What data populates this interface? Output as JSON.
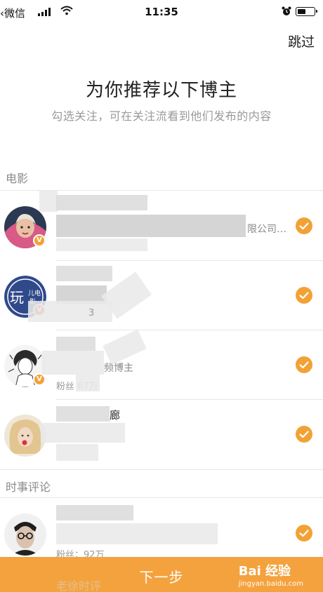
{
  "status_bar": {
    "back_app": "微信",
    "time": "11:35"
  },
  "header": {
    "skip_label": "跳过",
    "title": "为你推荐以下博主",
    "subtitle": "勾选关注，可在关注流看到他们发布的内容"
  },
  "sections": [
    {
      "title": "电影",
      "bloggers": [
        {
          "name": "",
          "desc": "限公司…",
          "fans": "",
          "verified": true,
          "checked": true,
          "avatar": "movie-character-avatar"
        },
        {
          "name": "",
          "desc": "",
          "fans": "3",
          "verified": true,
          "checked": true,
          "avatar": "movie-logo-avatar"
        },
        {
          "name": "",
          "desc": "频博主",
          "fans": "粉丝 67万",
          "verified": true,
          "checked": true,
          "avatar": "sketch-girl-avatar"
        },
        {
          "name": "廊",
          "desc": "",
          "fans": "",
          "verified": false,
          "checked": true,
          "avatar": "blonde-woman-avatar"
        }
      ]
    },
    {
      "title": "时事评论",
      "bloggers": [
        {
          "name": "",
          "desc": "",
          "fans": "粉丝：92万",
          "verified": false,
          "checked": true,
          "avatar": "man-glasses-avatar"
        }
      ]
    }
  ],
  "footer": {
    "next_label": "下一步",
    "peek_name": "老徐时评",
    "watermark_main": "Bai 经验",
    "watermark_sub": "jingyan.baidu.com"
  },
  "colors": {
    "accent": "#f4a23e",
    "check": "#f2a235",
    "verified": "#f2a235"
  },
  "icons": [
    "back-icon",
    "signal-icon",
    "wifi-icon",
    "alarm-icon",
    "battery-icon",
    "check-icon",
    "verified-badge-icon"
  ]
}
